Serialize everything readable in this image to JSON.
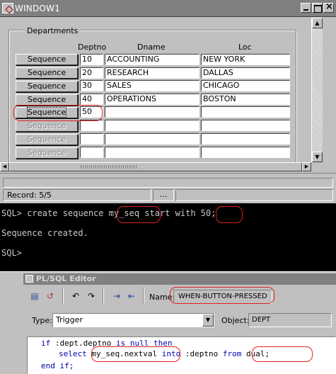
{
  "window": {
    "title": "WINDOW1"
  },
  "form": {
    "frame_title": "Departments",
    "columns": {
      "deptno": "Deptno",
      "dname": "Dname",
      "loc": "Loc"
    },
    "button_label": "Sequence",
    "rows": [
      {
        "deptno": "10",
        "dname": "ACCOUNTING",
        "loc": "NEW YORK"
      },
      {
        "deptno": "20",
        "dname": "RESEARCH",
        "loc": "DALLAS"
      },
      {
        "deptno": "30",
        "dname": "SALES",
        "loc": "CHICAGO"
      },
      {
        "deptno": "40",
        "dname": "OPERATIONS",
        "loc": "BOSTON"
      },
      {
        "deptno": "50",
        "dname": "",
        "loc": ""
      },
      {
        "deptno": "",
        "dname": "",
        "loc": ""
      },
      {
        "deptno": "",
        "dname": "",
        "loc": ""
      },
      {
        "deptno": "",
        "dname": "",
        "loc": ""
      }
    ]
  },
  "status": {
    "record": "Record: 5/5",
    "ellipsis": "..."
  },
  "console": {
    "line1_prompt": "SQL> create sequence ",
    "line1_name": "my_seq",
    "line1_mid": " start with ",
    "line1_value": "50;",
    "line2": "Sequence created.",
    "line3": "SQL>"
  },
  "editor": {
    "title": "PL/SQL Editor",
    "name_label": "Name:",
    "name_value": "WHEN-BUTTON-PRESSED",
    "type_label": "Type:",
    "type_value": "Trigger",
    "object_label": "Object:",
    "object_value": "DEPT",
    "code": {
      "l1_kw_if": "if",
      "l1_cond": " :dept.deptno ",
      "l1_kw_is_null_then": "is null then",
      "l2_kw_select": "select",
      "l2_expr": "my_seq.nextval",
      "l2_kw_into": "into",
      "l2_target": ":deptno",
      "l2_kw_from": "from",
      "l2_table": "dual;",
      "l3_kw_end": "end if;"
    }
  },
  "colors": {
    "highlight": "#e02020",
    "keyword": "#0000b0",
    "console_bg": "#000000",
    "window_face": "#c0c0c0"
  },
  "icons": {
    "window": "oracle-forms-window-icon",
    "minimize": "minimize-icon",
    "maximize": "maximize-icon",
    "close": "close-icon",
    "compile": "compile-icon",
    "revert": "revert-icon",
    "undo": "undo-icon",
    "redo": "redo-icon",
    "indent": "indent-icon",
    "outdent": "outdent-icon"
  }
}
